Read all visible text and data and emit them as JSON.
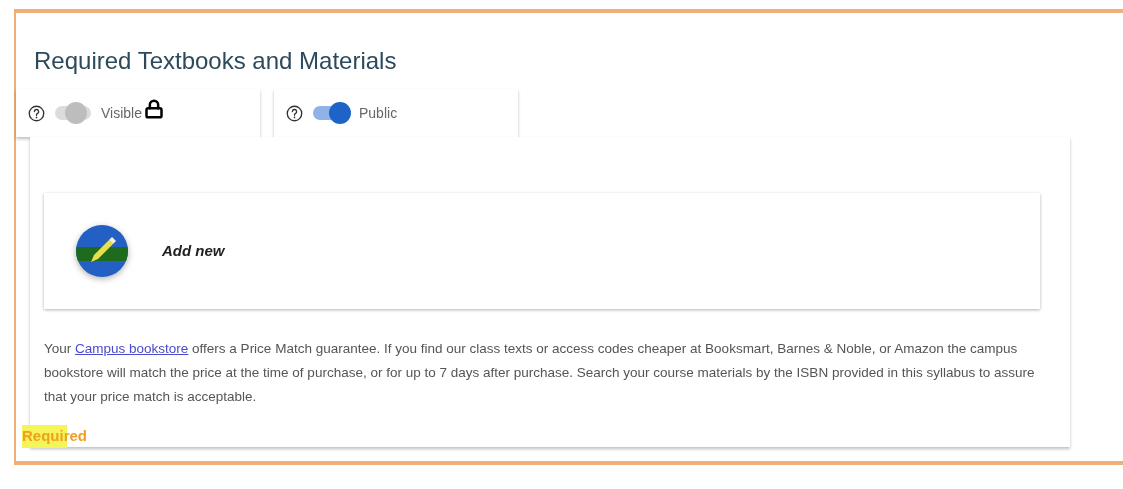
{
  "title": "Required Textbooks and Materials",
  "toggles": [
    {
      "label": "Visible",
      "on": false,
      "locked": true
    },
    {
      "label": "Public",
      "on": true,
      "locked": false
    }
  ],
  "add_new": {
    "label": "Add new"
  },
  "notice": {
    "before": "Your ",
    "link": "Campus bookstore",
    "after": " offers a Price Match guarantee. If you find our class texts or access codes cheaper at Booksmart, Barnes & Noble, or Amazon the campus bookstore will match the price at the time of purchase, or for up to 7 days after purchase. Search your course materials by the ISBN provided in this syllabus to assure that your price match is acceptable."
  },
  "required_label": "Required"
}
